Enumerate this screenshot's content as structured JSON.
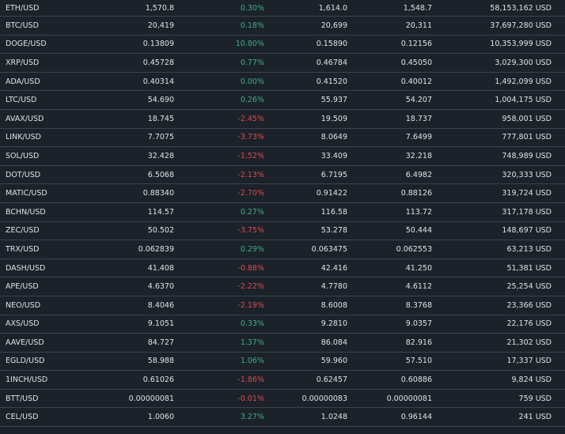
{
  "colors": {
    "background": "#1b222a",
    "row_border": "#3a444e",
    "text": "#dfe3e8",
    "positive": "#3fae84",
    "negative": "#e0484c"
  },
  "rows": [
    {
      "pair": "ETH/USD",
      "last": "1,570.8",
      "change": "0.30%",
      "dir": "pos",
      "high": "1,614.0",
      "low": "1,548.7",
      "volume": "58,153,162 USD"
    },
    {
      "pair": "BTC/USD",
      "last": "20,419",
      "change": "0.18%",
      "dir": "pos",
      "high": "20,699",
      "low": "20,311",
      "volume": "37,697,280 USD"
    },
    {
      "pair": "DOGE/USD",
      "last": "0.13809",
      "change": "10.80%",
      "dir": "pos",
      "high": "0.15890",
      "low": "0.12156",
      "volume": "10,353,999 USD"
    },
    {
      "pair": "XRP/USD",
      "last": "0.45728",
      "change": "0.77%",
      "dir": "pos",
      "high": "0.46784",
      "low": "0.45050",
      "volume": "3,029,300 USD"
    },
    {
      "pair": "ADA/USD",
      "last": "0.40314",
      "change": "0.00%",
      "dir": "pos",
      "high": "0.41520",
      "low": "0.40012",
      "volume": "1,492,099 USD"
    },
    {
      "pair": "LTC/USD",
      "last": "54.690",
      "change": "0.26%",
      "dir": "pos",
      "high": "55.937",
      "low": "54.207",
      "volume": "1,004,175 USD"
    },
    {
      "pair": "AVAX/USD",
      "last": "18.745",
      "change": "-2.45%",
      "dir": "neg",
      "high": "19.509",
      "low": "18.737",
      "volume": "958,001 USD"
    },
    {
      "pair": "LINK/USD",
      "last": "7.7075",
      "change": "-3.73%",
      "dir": "neg",
      "high": "8.0649",
      "low": "7.6499",
      "volume": "777,801 USD"
    },
    {
      "pair": "SOL/USD",
      "last": "32.428",
      "change": "-1.52%",
      "dir": "neg",
      "high": "33.409",
      "low": "32.218",
      "volume": "748,989 USD"
    },
    {
      "pair": "DOT/USD",
      "last": "6.5068",
      "change": "-2.13%",
      "dir": "neg",
      "high": "6.7195",
      "low": "6.4982",
      "volume": "320,333 USD"
    },
    {
      "pair": "MATIC/USD",
      "last": "0.88340",
      "change": "-2.70%",
      "dir": "neg",
      "high": "0.91422",
      "low": "0.88126",
      "volume": "319,724 USD"
    },
    {
      "pair": "BCHN/USD",
      "last": "114.57",
      "change": "0.27%",
      "dir": "pos",
      "high": "116.58",
      "low": "113.72",
      "volume": "317,178 USD"
    },
    {
      "pair": "ZEC/USD",
      "last": "50.502",
      "change": "-3.75%",
      "dir": "neg",
      "high": "53.278",
      "low": "50.444",
      "volume": "148,697 USD"
    },
    {
      "pair": "TRX/USD",
      "last": "0.062839",
      "change": "0.29%",
      "dir": "pos",
      "high": "0.063475",
      "low": "0.062553",
      "volume": "63,213 USD"
    },
    {
      "pair": "DASH/USD",
      "last": "41.408",
      "change": "-0.88%",
      "dir": "neg",
      "high": "42.416",
      "low": "41.250",
      "volume": "51,381 USD"
    },
    {
      "pair": "APE/USD",
      "last": "4.6370",
      "change": "-2.22%",
      "dir": "neg",
      "high": "4.7780",
      "low": "4.6112",
      "volume": "25,254 USD"
    },
    {
      "pair": "NEO/USD",
      "last": "8.4046",
      "change": "-2.19%",
      "dir": "neg",
      "high": "8.6008",
      "low": "8.3768",
      "volume": "23,366 USD"
    },
    {
      "pair": "AXS/USD",
      "last": "9.1051",
      "change": "0.33%",
      "dir": "pos",
      "high": "9.2810",
      "low": "9.0357",
      "volume": "22,176 USD"
    },
    {
      "pair": "AAVE/USD",
      "last": "84.727",
      "change": "1.37%",
      "dir": "pos",
      "high": "86.084",
      "low": "82.916",
      "volume": "21,302 USD"
    },
    {
      "pair": "EGLD/USD",
      "last": "58.988",
      "change": "1.06%",
      "dir": "pos",
      "high": "59.960",
      "low": "57.510",
      "volume": "17,337 USD"
    },
    {
      "pair": "1INCH/USD",
      "last": "0.61026",
      "change": "-1.86%",
      "dir": "neg",
      "high": "0.62457",
      "low": "0.60886",
      "volume": "9,824 USD"
    },
    {
      "pair": "BTT/USD",
      "last": "0.00000081",
      "change": "-0.01%",
      "dir": "neg",
      "high": "0.00000083",
      "low": "0.00000081",
      "volume": "759 USD"
    },
    {
      "pair": "CEL/USD",
      "last": "1.0060",
      "change": "3.27%",
      "dir": "pos",
      "high": "1.0248",
      "low": "0.96144",
      "volume": "241 USD"
    }
  ]
}
